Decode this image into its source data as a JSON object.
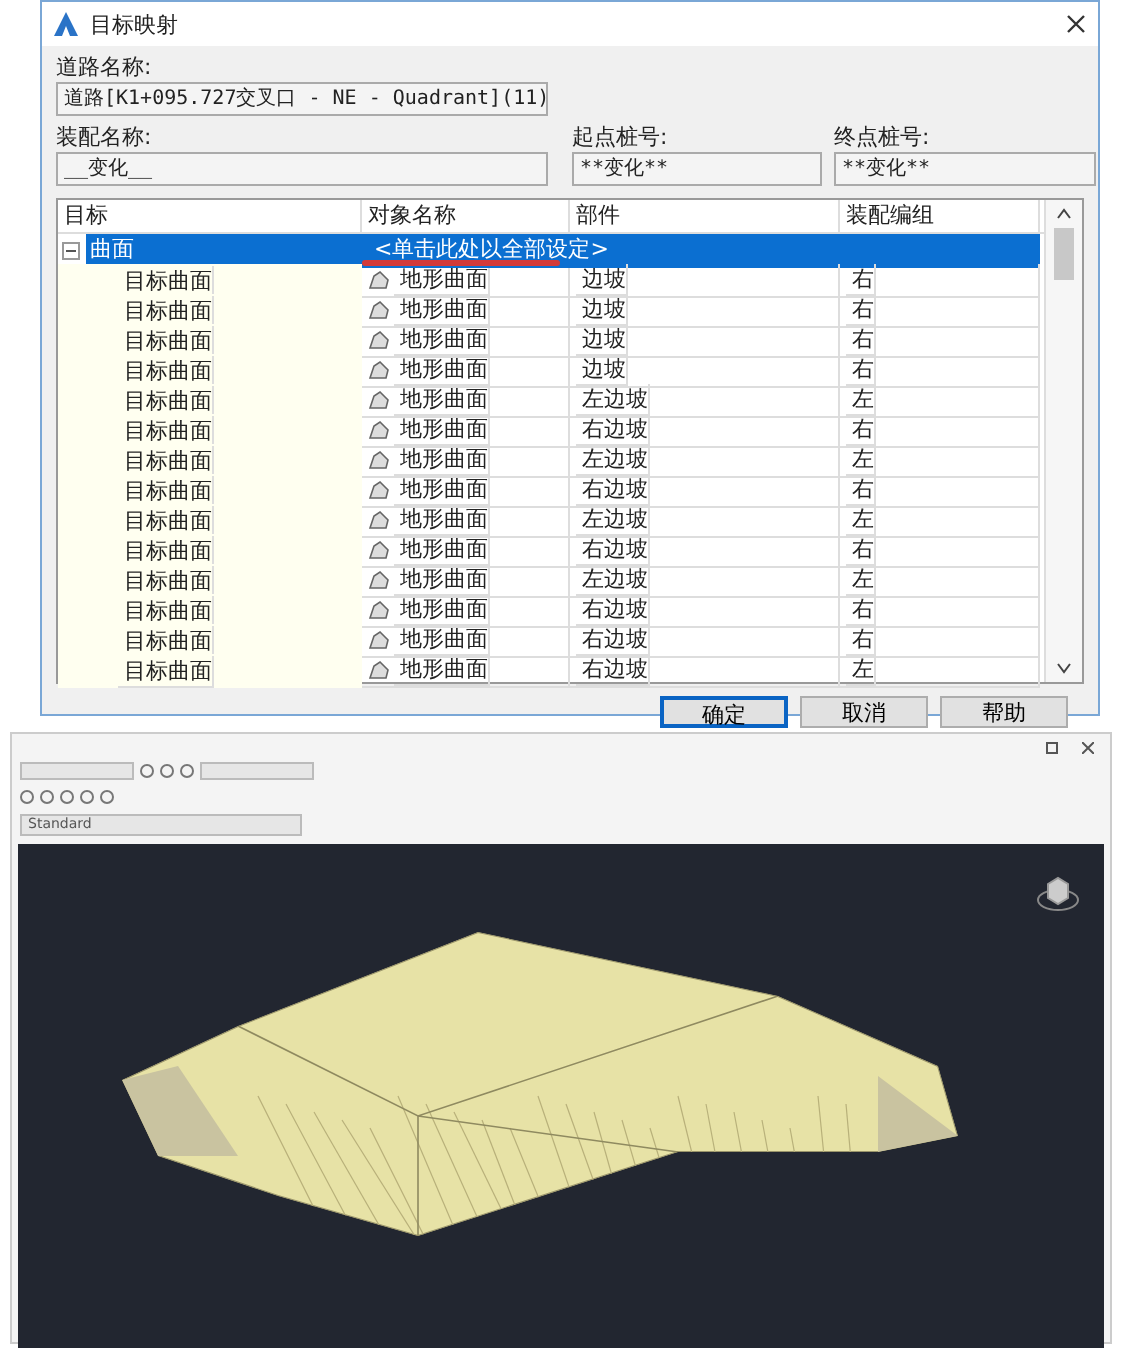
{
  "dialog": {
    "title": "目标映射",
    "road_label": "道路名称:",
    "road_value": "道路[K1+095.727交叉口 - NE - Quadrant](11)",
    "assembly_label": "装配名称:",
    "assembly_value": "__变化__",
    "start_label": "起点桩号:",
    "start_value": "**变化**",
    "end_label": "终点桩号:",
    "end_value": "**变化**",
    "columns": [
      "目标",
      "对象名称",
      "部件",
      "装配编组"
    ],
    "root": {
      "label": "曲面",
      "object": "<单击此处以全部设定>",
      "selected": true,
      "expanded": true,
      "underlined": true,
      "children": [
        {
          "label": "目标曲面",
          "object": "地形曲面",
          "part": "边坡",
          "group": "右",
          "selected": false
        },
        {
          "label": "目标曲面",
          "object": "地形曲面",
          "part": "边坡",
          "group": "右",
          "selected": false
        },
        {
          "label": "目标曲面",
          "object": "地形曲面",
          "part": "边坡",
          "group": "右",
          "selected": false
        },
        {
          "label": "目标曲面",
          "object": "地形曲面",
          "part": "边坡",
          "group": "右",
          "selected": false
        },
        {
          "label": "目标曲面",
          "object": "地形曲面",
          "part": "左边坡",
          "group": "左",
          "selected": false
        },
        {
          "label": "目标曲面",
          "object": "地形曲面",
          "part": "右边坡",
          "group": "右",
          "selected": false
        },
        {
          "label": "目标曲面",
          "object": "地形曲面",
          "part": "左边坡",
          "group": "左",
          "selected": false
        },
        {
          "label": "目标曲面",
          "object": "地形曲面",
          "part": "右边坡",
          "group": "右",
          "selected": false
        },
        {
          "label": "目标曲面",
          "object": "地形曲面",
          "part": "左边坡",
          "group": "左",
          "selected": false
        },
        {
          "label": "目标曲面",
          "object": "地形曲面",
          "part": "右边坡",
          "group": "右",
          "selected": false
        },
        {
          "label": "目标曲面",
          "object": "地形曲面",
          "part": "左边坡",
          "group": "左",
          "selected": false
        },
        {
          "label": "目标曲面",
          "object": "地形曲面",
          "part": "右边坡",
          "group": "右",
          "selected": false
        },
        {
          "label": "目标曲面",
          "object": "地形曲面",
          "part": "右边坡",
          "group": "右",
          "selected": false
        },
        {
          "label": "目标曲面",
          "object": "地形曲面",
          "part": "右边坡",
          "group": "左",
          "selected": false
        }
      ]
    },
    "buttons": [
      {
        "label": "确定",
        "default": true
      },
      {
        "label": "取消",
        "default": false
      },
      {
        "label": "帮助",
        "default": false
      }
    ]
  },
  "viewer": {
    "style": "Standard"
  }
}
